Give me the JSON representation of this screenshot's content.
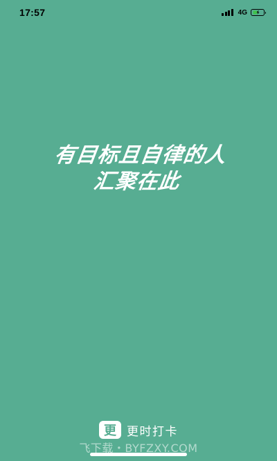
{
  "status_bar": {
    "time": "17:57",
    "network": "4G",
    "battery_icon": "battery-charging-icon",
    "signal_icon": "signal-icon"
  },
  "slogan": {
    "line1": "有目标且自律的人",
    "line2": "汇聚在此"
  },
  "brand": {
    "logo_glyph": "更",
    "name": "更时打卡"
  },
  "watermark": "飞下载・BYFZXY.COM",
  "colors": {
    "background": "#57ad92",
    "text": "#ffffff",
    "battery_charge": "#3fc14a"
  }
}
